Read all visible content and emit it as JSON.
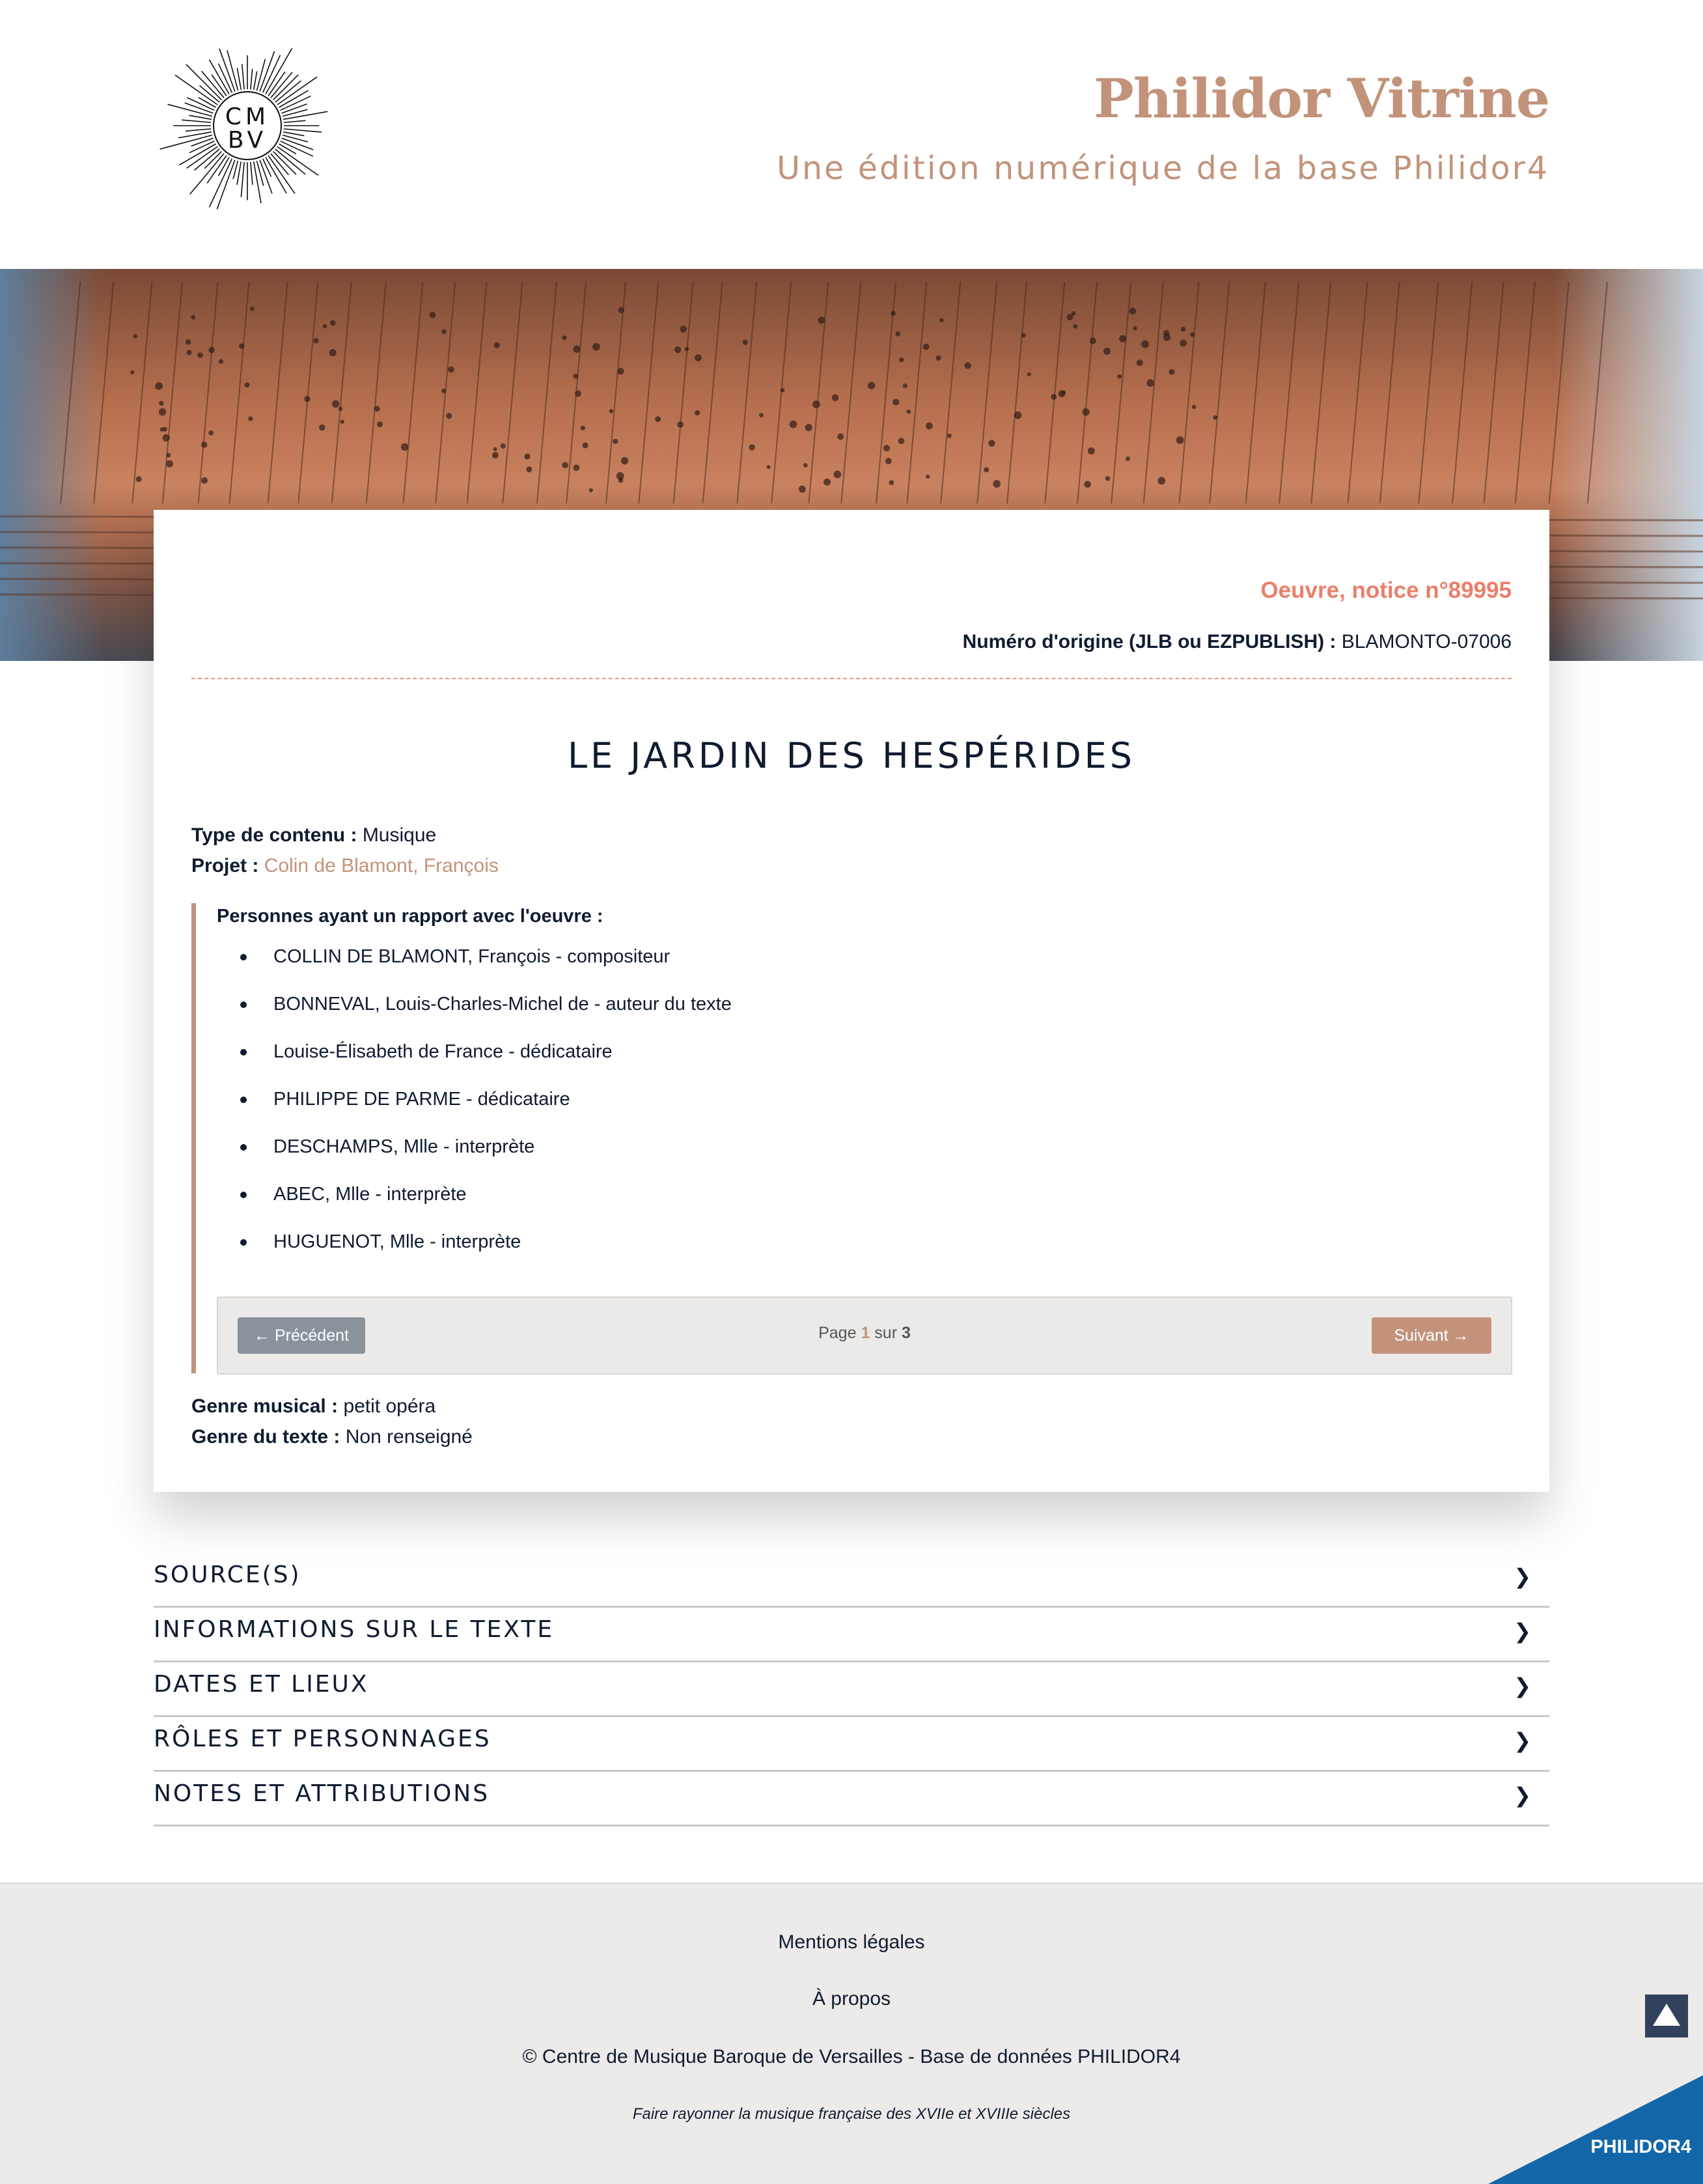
{
  "header": {
    "logo_text": "CM\nBV",
    "logo_line1": "CM",
    "logo_line2": "BV",
    "title": "Philidor Vitrine",
    "subtitle": "Une édition numérique de la base Philidor4"
  },
  "notice": {
    "heading": "Oeuvre, notice n°89995",
    "origin_label": "Numéro d'origine (JLB ou EZPUBLISH) :",
    "origin_value": "BLAMONTO-07006",
    "title": "LE JARDIN DES HESPÉRIDES",
    "type_label": "Type de contenu :",
    "type_value": "Musique",
    "project_label": "Projet :",
    "project_value": "Colin de Blamont, François",
    "persons_heading": "Personnes ayant un rapport avec l'oeuvre :",
    "persons": [
      "COLLIN DE BLAMONT, François - compositeur",
      "BONNEVAL, Louis-Charles-Michel de - auteur du texte",
      "Louise-Élisabeth de France - dédicataire",
      "PHILIPPE DE PARME - dédicataire",
      "DESCHAMPS, Mlle - interprète",
      "ABEC, Mlle - interprète",
      "HUGUENOT, Mlle - interprète"
    ],
    "pager": {
      "prev_label": "← Précédent",
      "next_label": "Suivant →",
      "page_word": "Page",
      "current": "1",
      "of_word": "sur",
      "total": "3"
    },
    "genre_label": "Genre musical :",
    "genre_value": "petit opéra",
    "text_genre_label": "Genre du texte :",
    "text_genre_value": "Non renseigné"
  },
  "accordion": [
    {
      "label": "SOURCE(S)",
      "chevron": "❯"
    },
    {
      "label": "INFORMATIONS SUR LE TEXTE",
      "chevron": "❯"
    },
    {
      "label": "DATES ET LIEUX",
      "chevron": "❯"
    },
    {
      "label": "RÔLES ET PERSONNAGES",
      "chevron": "❯"
    },
    {
      "label": "NOTES ET ATTRIBUTIONS",
      "chevron": "❯"
    }
  ],
  "footer": {
    "legal": "Mentions légales",
    "about": "À propos",
    "copyright": "© Centre de Musique Baroque de Versailles - Base de données PHILIDOR4",
    "tagline": "Faire rayonner la musique française des XVIIe et XVIIIe siècles",
    "badge": "PHILIDOR4",
    "to_top_icon": "arrow-up-icon"
  },
  "colors": {
    "accent": "#c2937a",
    "notice_heading": "#ea7f6a",
    "text": "#0f1b30",
    "badge_bg": "#1367a8",
    "to_top_bg": "#33425c"
  }
}
